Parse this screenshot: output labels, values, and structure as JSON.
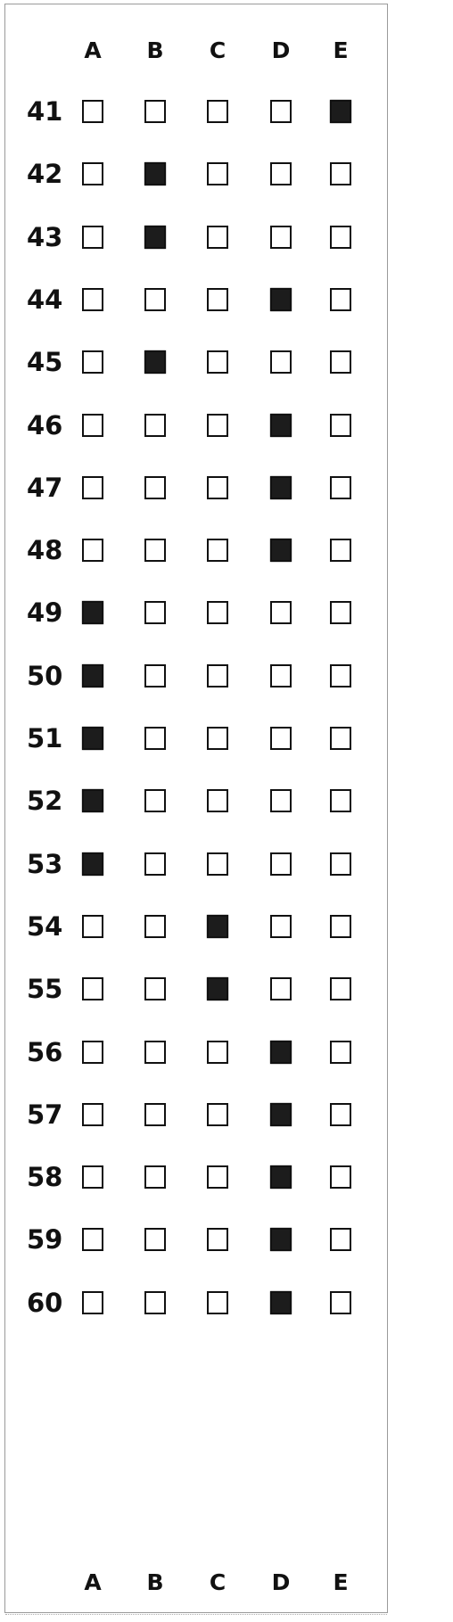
{
  "columns": [
    "A",
    "B",
    "C",
    "D",
    "E"
  ],
  "questions": [
    {
      "number": "41",
      "marked": "E"
    },
    {
      "number": "42",
      "marked": "B"
    },
    {
      "number": "43",
      "marked": "B"
    },
    {
      "number": "44",
      "marked": "D"
    },
    {
      "number": "45",
      "marked": "B"
    },
    {
      "number": "46",
      "marked": "D"
    },
    {
      "number": "47",
      "marked": "D"
    },
    {
      "number": "48",
      "marked": "D"
    },
    {
      "number": "49",
      "marked": "A"
    },
    {
      "number": "50",
      "marked": "A"
    },
    {
      "number": "51",
      "marked": "A"
    },
    {
      "number": "52",
      "marked": "A"
    },
    {
      "number": "53",
      "marked": "A"
    },
    {
      "number": "54",
      "marked": "C"
    },
    {
      "number": "55",
      "marked": "C"
    },
    {
      "number": "56",
      "marked": "D"
    },
    {
      "number": "57",
      "marked": "D"
    },
    {
      "number": "58",
      "marked": "D"
    },
    {
      "number": "59",
      "marked": "D"
    },
    {
      "number": "60",
      "marked": "D"
    }
  ],
  "colors": {
    "ink": "#111111",
    "fill": "#1c1c1c",
    "border": "#9a9a9a"
  }
}
